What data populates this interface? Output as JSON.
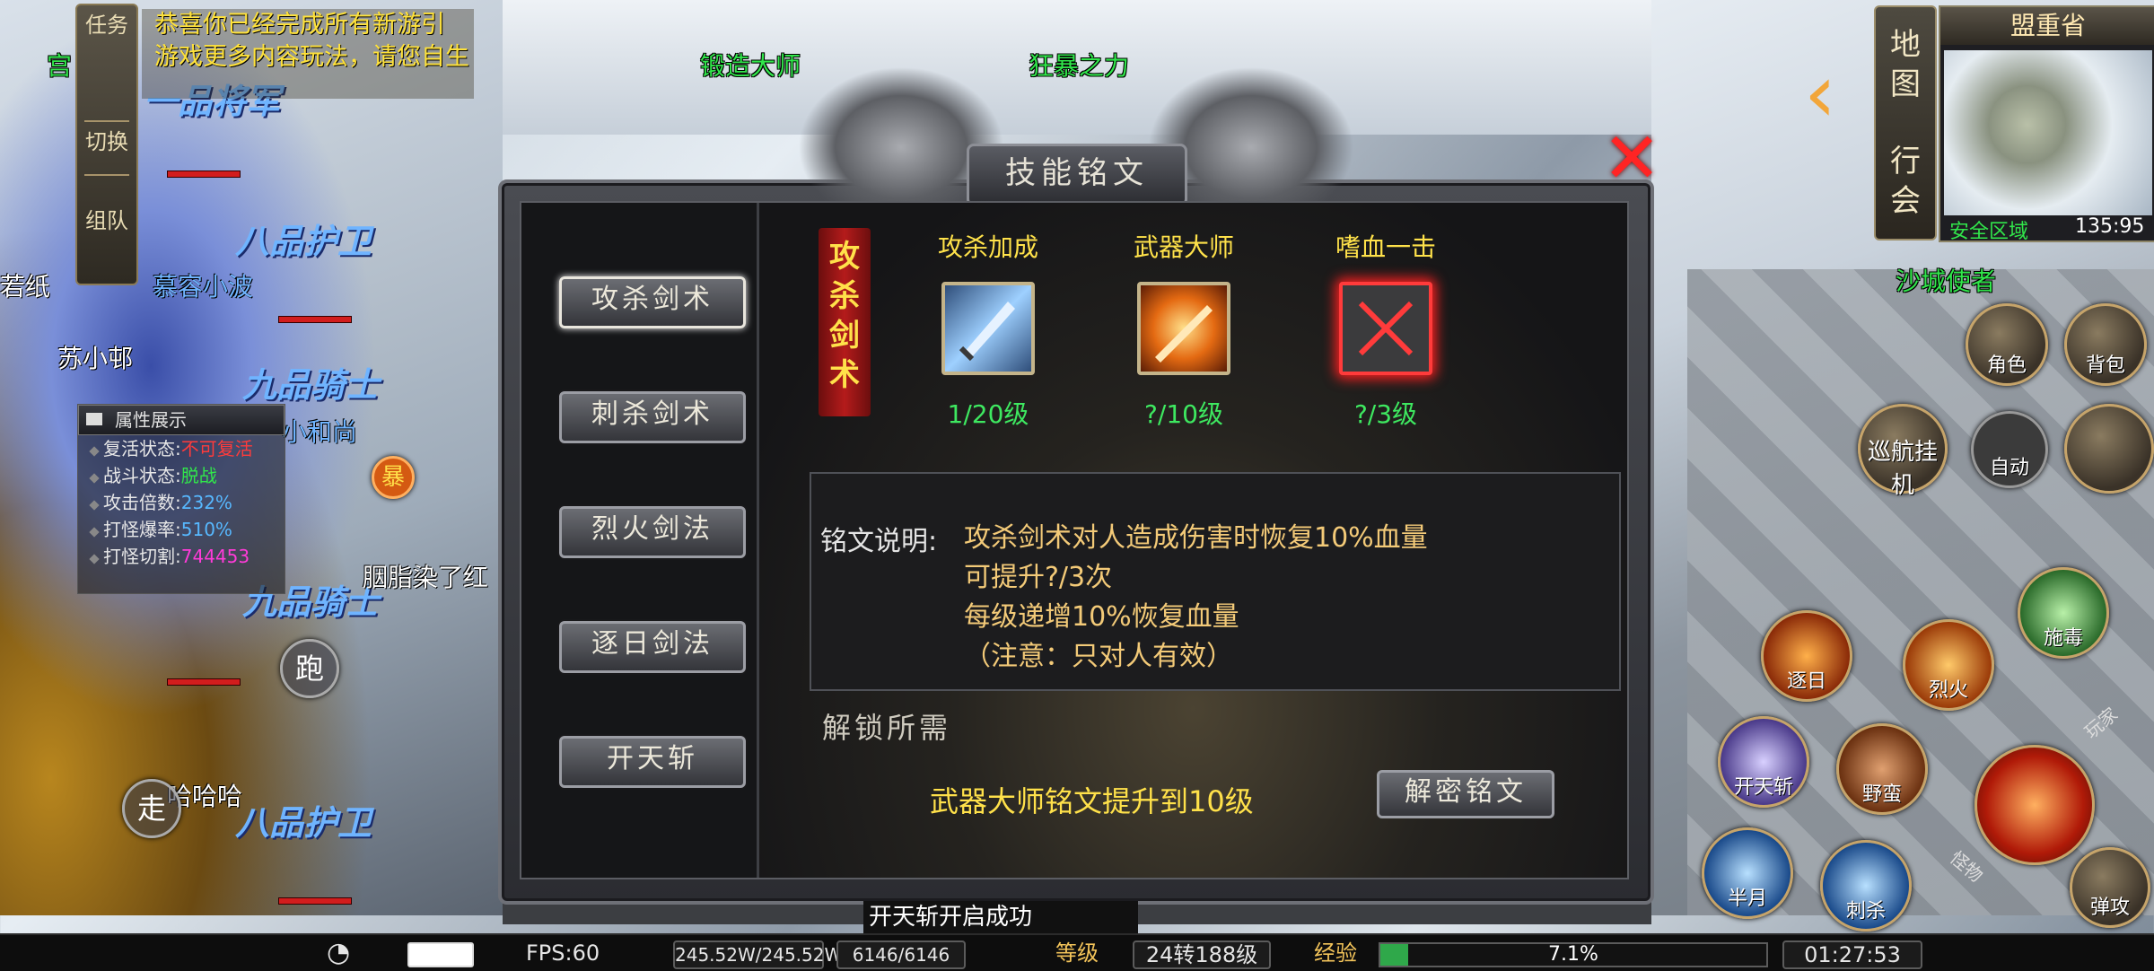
{
  "notice": {
    "line1": "恭喜你已经完成所有新游引",
    "line2": "游戏更多内容玩法，请您自生"
  },
  "side_tabs": {
    "task": "任务",
    "switch": "切换",
    "team": "组队"
  },
  "world_labels": {
    "forging_master": "锻造大师",
    "berserk": "狂暴之力",
    "sand_city_envoy": "沙城使者",
    "blue1": "一品将军",
    "blue2": "八品护卫",
    "blue3": "九品骑士",
    "blue4": "九品骑士",
    "blue5": "八品护卫",
    "name1": "若纸",
    "name2": "慕容小波",
    "name3": "苏小邨",
    "name4": "小和尚",
    "name5": "哈哈哈",
    "name6": "胭脂染了红",
    "name7": "宫",
    "run": "跑",
    "walk": "走",
    "bao": "暴"
  },
  "attributes": {
    "title": "属性展示",
    "rows": [
      {
        "key": "复活状态:",
        "value": "不可复活",
        "color": "#ff3b3b"
      },
      {
        "key": "战斗状态:",
        "value": "脱战",
        "color": "#31e64b"
      },
      {
        "key": "攻击倍数:",
        "value": "232%",
        "color": "#57b8ff"
      },
      {
        "key": "打怪爆率:",
        "value": "510%",
        "color": "#57b8ff"
      },
      {
        "key": "打怪切割:",
        "value": "744453",
        "color": "#ff3bd8"
      }
    ]
  },
  "dialog": {
    "title": "技能铭文",
    "close_icon": "close-x-icon",
    "skills": [
      "攻杀剑术",
      "刺杀剑术",
      "烈火剑法",
      "逐日剑法",
      "开天斩"
    ],
    "active_skill_index": 0,
    "banner": "攻杀剑术",
    "runes": [
      {
        "name": "攻杀加成",
        "level": "1/20级",
        "icon": "blade-icon",
        "selected": false
      },
      {
        "name": "武器大师",
        "level": "?/10级",
        "icon": "fire-sword-icon",
        "selected": false
      },
      {
        "name": "嗜血一击",
        "level": "?/3级",
        "icon": "blood-strike-icon",
        "selected": true
      }
    ],
    "desc_label": "铭文说明:",
    "desc_lines": [
      "攻杀剑术对人造成伤害时恢复10%血量",
      "可提升?/3次",
      "每级递增10%恢复血量",
      "（注意：只对人有效）"
    ],
    "unlock_title": "解锁所需",
    "unlock_requirement": "武器大师铭文提升到10级",
    "unlock_button": "解密铭文"
  },
  "right_hud": {
    "map_btn": "地图",
    "guild_btn": "行会",
    "region": "盟重省",
    "safe_zone": "安全区域",
    "coords": "135:95",
    "role": "角色",
    "bag": "背包",
    "auto_hang": "巡航挂机",
    "auto": "自动",
    "skills": [
      "逐日",
      "烈火",
      "施毒",
      "开天斩",
      "野蛮",
      "半月",
      "刺杀",
      "弹攻"
    ],
    "misc": [
      "玩家",
      "怪物"
    ]
  },
  "toast": "开天斩开启成功",
  "statusbar": {
    "fps": "FPS:60",
    "hp": "245.52W/245.52W",
    "mp": "6146/6146",
    "level_label": "等级",
    "level": "24转188级",
    "exp_label": "经验",
    "exp_pct": "7.1%",
    "exp_fraction": 0.071,
    "time": "01:27:53"
  },
  "colors": {
    "accent_yellow": "#ffe24a",
    "level_green": "#3ee860",
    "desc_gold": "#f3ca78",
    "close_red": "#ff2424"
  }
}
